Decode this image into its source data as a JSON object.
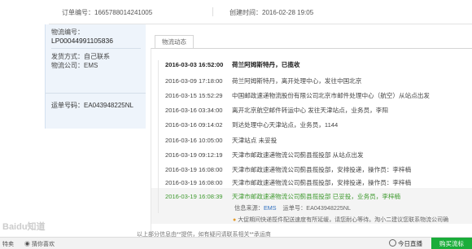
{
  "order": {
    "number_text": "订单编号：1665788014241005",
    "created_text": "创建时间：2016-02-28 19:05"
  },
  "logistics_info": {
    "number_label": "物流编号：",
    "number_value": "LP00044991105836",
    "ship_method": "发货方式：自己联系",
    "company": "物流公司：EMS",
    "waybill_label": "运单号码：",
    "waybill_value": "EA043948225NL"
  },
  "tab_label": "物流动态",
  "tracking": [
    {
      "time": "2016-03-03 16:52:00",
      "text": "荷兰阿姆斯特丹，已揽收"
    },
    {
      "time": "2016-03-09 17:18:00",
      "text": "荷兰阿姆斯特丹，离开处理中心，发往中国北京"
    },
    {
      "time": "2016-03-15 15:52:29",
      "text": "中国邮政速递物流股份有限公司北京市邮件处理中心（航空）从站点出发"
    },
    {
      "time": "2016-03-16 03:34:00",
      "text": "离开北京航空邮件转运中心 发往天津站点，业务员，李阳"
    },
    {
      "time": "2016-03-16 09:14:02",
      "text": "到达处理中心天津站点，业务员，1144"
    },
    {
      "time": "2016-03-16 10:05:00",
      "text": "天津站点 未妥投"
    },
    {
      "time": "2016-03-19 09:12:19",
      "text": "天津市邮政速递物流公司蓟县揽投部 从站点出发"
    },
    {
      "time": "2016-03-19 16:08:00",
      "text": "天津市邮政速递物流公司蓟县揽投部，安排投递，操作员：李梓楠"
    },
    {
      "time": "2016-03-19 16:08:00",
      "text": "天津市邮政速递物流公司蓟县揽投部，安排投递，操作员：李梓楠"
    },
    {
      "time": "2016-03-19 16:08:39",
      "text": "天津市邮政速递物流公司蓟县揽投部 已妥投，业务员，李梓楠"
    }
  ],
  "source": {
    "label": "信息来源：",
    "link": "EMS",
    "waybill": "运单号：EA043948225NL"
  },
  "notice": "大促期间快递揽件配送速度有所延缓，请您耐心等待。淘小二建议您联系物流公司确",
  "cut_text": "以上部分信息由**提供，如有疑问请联系相关**承运商",
  "watermark": "Baidu知道",
  "bottom": {
    "left1": "特卖",
    "left2": "猜你喜欢",
    "live": "今日直播",
    "buy": "购买流标"
  }
}
